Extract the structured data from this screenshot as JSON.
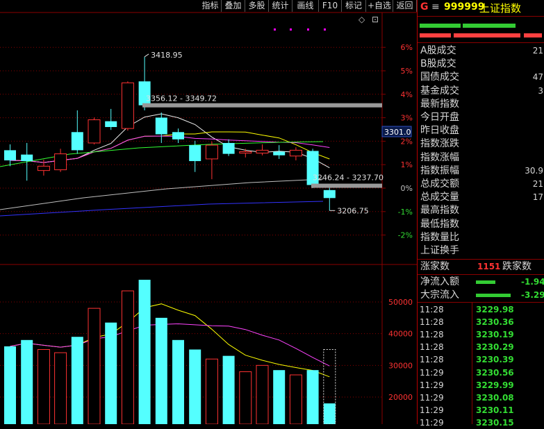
{
  "toolbar": {
    "buttons": [
      "指标",
      "叠加",
      "多股",
      "统计",
      "画线",
      "F10",
      "标记",
      "+自选",
      "返回"
    ]
  },
  "colors": {
    "up": "#ff3232",
    "down": "#54ffff",
    "ma5": "#f0f0f0",
    "ma10": "#ffff00",
    "ma20": "#ff44ff",
    "ma30": "#33ff33",
    "ma60": "#c0c0c0",
    "ma120": "#3333ff",
    "grid": "#8b0000"
  },
  "chart_data": {
    "type": "candlestick",
    "price_axis_pct": [
      "6%",
      "5%",
      "4%",
      "3%",
      "2%",
      "1%",
      "0%",
      "-1%",
      "-2%"
    ],
    "volume_axis": [
      "50000",
      "40000",
      "30000",
      "20000"
    ],
    "current_price_tag": "3301.0",
    "annotations": {
      "high": "3418.95",
      "range_upper": "3356.12 - 3349.72",
      "range_lower": "3246.24 - 3237.70",
      "low": "3206.75"
    },
    "candles": [
      {
        "o": 3290,
        "h": 3298,
        "l": 3268,
        "c": 3276,
        "dir": "down",
        "vol": 36000,
        "vdir": "down"
      },
      {
        "o": 3284,
        "h": 3300,
        "l": 3248,
        "c": 3275,
        "dir": "down",
        "vol": 38000,
        "vdir": "down"
      },
      {
        "o": 3262,
        "h": 3277,
        "l": 3255,
        "c": 3268,
        "dir": "up",
        "vol": 35000,
        "vdir": "up"
      },
      {
        "o": 3263,
        "h": 3292,
        "l": 3260,
        "c": 3285,
        "dir": "up",
        "vol": 34000,
        "vdir": "up"
      },
      {
        "o": 3315,
        "h": 3345,
        "l": 3285,
        "c": 3290,
        "dir": "down",
        "vol": 39000,
        "vdir": "down"
      },
      {
        "o": 3300,
        "h": 3335,
        "l": 3298,
        "c": 3332,
        "dir": "up",
        "vol": 48000,
        "vdir": "up"
      },
      {
        "o": 3330,
        "h": 3347,
        "l": 3318,
        "c": 3322,
        "dir": "down",
        "vol": 43500,
        "vdir": "down"
      },
      {
        "o": 3320,
        "h": 3385,
        "l": 3317,
        "c": 3383,
        "dir": "up",
        "vol": 53500,
        "vdir": "up"
      },
      {
        "o": 3385,
        "h": 3418.95,
        "l": 3345,
        "c": 3352,
        "dir": "down",
        "vol": 57000,
        "vdir": "down"
      },
      {
        "o": 3335,
        "h": 3342,
        "l": 3300,
        "c": 3312,
        "dir": "down",
        "vol": 45000,
        "vdir": "down"
      },
      {
        "o": 3315,
        "h": 3320,
        "l": 3300,
        "c": 3305,
        "dir": "down",
        "vol": 38000,
        "vdir": "down"
      },
      {
        "o": 3297,
        "h": 3303,
        "l": 3260,
        "c": 3275,
        "dir": "down",
        "vol": 35000,
        "vdir": "down"
      },
      {
        "o": 3278,
        "h": 3302,
        "l": 3250,
        "c": 3297,
        "dir": "up",
        "vol": 32000,
        "vdir": "up"
      },
      {
        "o": 3300,
        "h": 3305,
        "l": 3282,
        "c": 3285,
        "dir": "down",
        "vol": 33000,
        "vdir": "down"
      },
      {
        "o": 3286,
        "h": 3292,
        "l": 3280,
        "c": 3288,
        "dir": "up",
        "vol": 28000,
        "vdir": "up"
      },
      {
        "o": 3286,
        "h": 3298,
        "l": 3283,
        "c": 3290,
        "dir": "up",
        "vol": 30000,
        "vdir": "up"
      },
      {
        "o": 3288,
        "h": 3297,
        "l": 3278,
        "c": 3283,
        "dir": "down",
        "vol": 28500,
        "vdir": "down"
      },
      {
        "o": 3282,
        "h": 3294,
        "l": 3276,
        "c": 3290,
        "dir": "up",
        "vol": 27000,
        "vdir": "up"
      },
      {
        "o": 3289,
        "h": 3292,
        "l": 3237.7,
        "c": 3242,
        "dir": "down",
        "vol": 28500,
        "vdir": "down"
      },
      {
        "o": 3235,
        "h": 3240,
        "l": 3206.75,
        "c": 3224,
        "dir": "down",
        "vol": 18000,
        "vdir": "down"
      }
    ]
  },
  "side": {
    "header_logo": "G",
    "header_icon": "≡",
    "code": "999999",
    "name": "上证指数",
    "rows": [
      {
        "label": "A股成交",
        "value": "21"
      },
      {
        "label": "B股成交",
        "value": ""
      },
      {
        "label": "国债成交",
        "value": "47"
      },
      {
        "label": "基金成交",
        "value": "3"
      },
      {
        "label": "最新指数",
        "value": ""
      },
      {
        "label": "今日开盘",
        "value": ""
      },
      {
        "label": "昨日收盘",
        "value": ""
      },
      {
        "label": "指数涨跌",
        "value": ""
      },
      {
        "label": "指数涨幅",
        "value": ""
      },
      {
        "label": "指数振幅",
        "value": "30.9"
      },
      {
        "label": "总成交额",
        "value": "21"
      },
      {
        "label": "总成交量",
        "value": "17"
      },
      {
        "label": "最高指数",
        "value": ""
      },
      {
        "label": "最低指数",
        "value": ""
      },
      {
        "label": "指数量比",
        "value": ""
      },
      {
        "label": "上证换手",
        "value": ""
      }
    ],
    "adv_label": "涨家数",
    "adv_value": "1151",
    "dec_label": "跌家数",
    "inflow_label": "净流入额",
    "inflow_value": "-1.94",
    "block_label": "大宗流入",
    "block_value": "-3.29",
    "ticks": [
      {
        "time": "11:28",
        "price": "3229.98"
      },
      {
        "time": "11:28",
        "price": "3230.36"
      },
      {
        "time": "11:28",
        "price": "3230.19"
      },
      {
        "time": "11:28",
        "price": "3230.29"
      },
      {
        "time": "11:28",
        "price": "3230.39"
      },
      {
        "time": "11:29",
        "price": "3230.56"
      },
      {
        "time": "11:29",
        "price": "3229.99"
      },
      {
        "time": "11:29",
        "price": "3230.08"
      },
      {
        "time": "11:29",
        "price": "3230.11"
      },
      {
        "time": "11:29",
        "price": "3230.15"
      }
    ]
  }
}
